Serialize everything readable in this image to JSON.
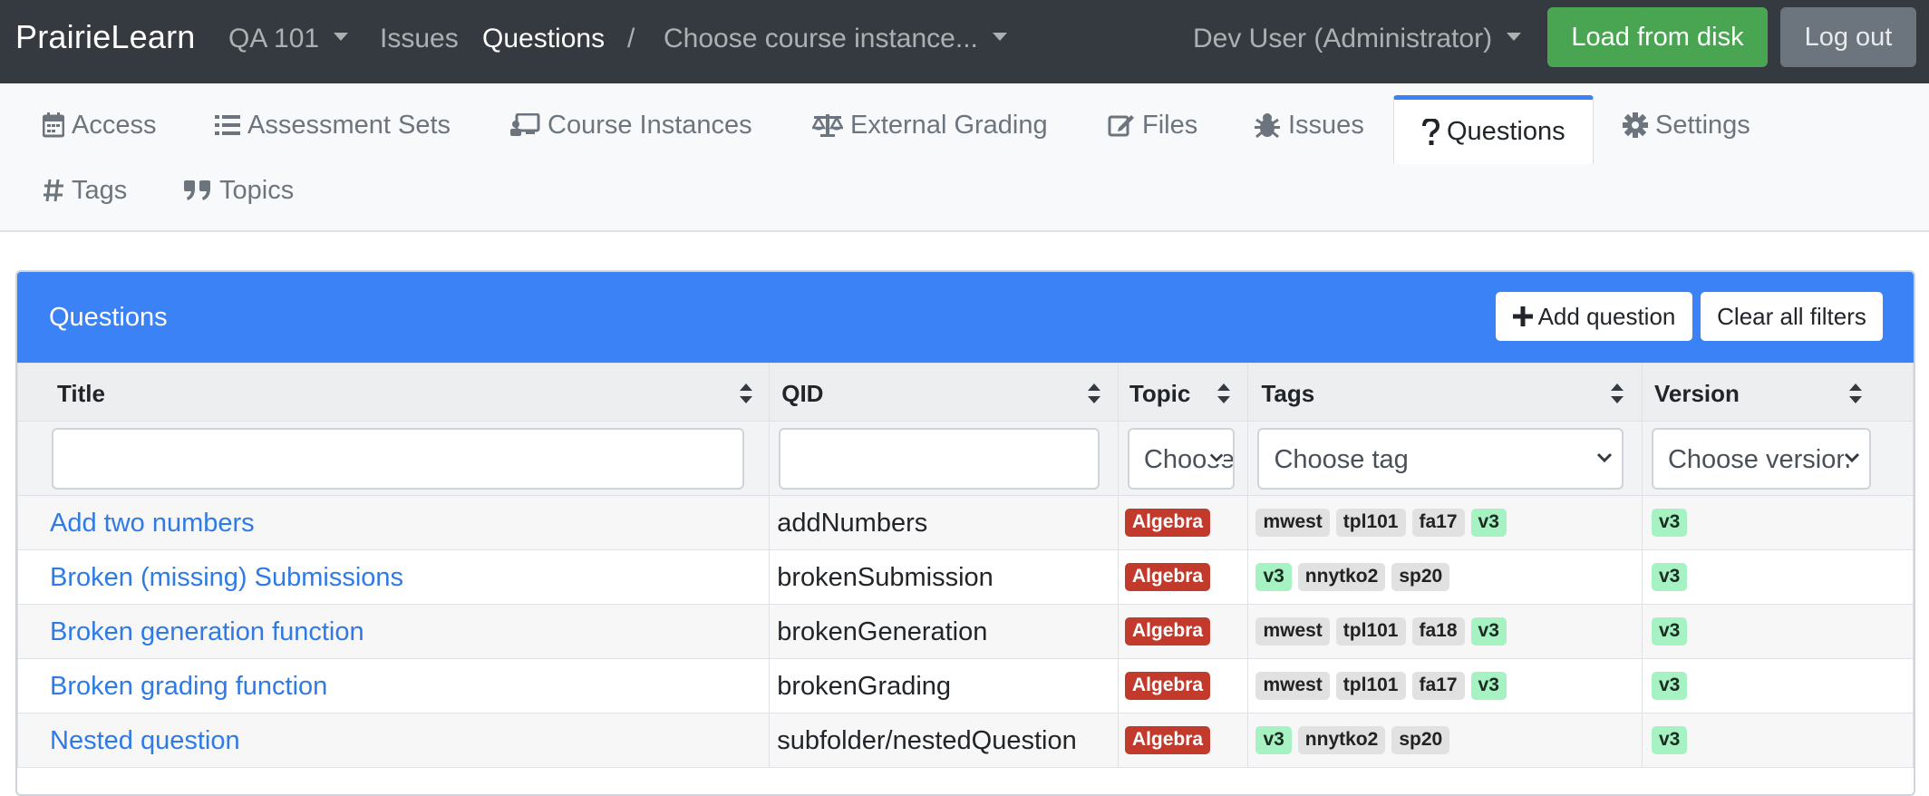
{
  "navbar": {
    "brand": "PrairieLearn",
    "course": "QA 101",
    "issues": "Issues",
    "questions": "Questions",
    "separator": "/",
    "instance": "Choose course instance...",
    "user": "Dev User (Administrator)",
    "load_button": "Load from disk",
    "logout_button": "Log out"
  },
  "tabs": [
    {
      "label": "Access",
      "icon": "calendar-icon"
    },
    {
      "label": "Assessment Sets",
      "icon": "list-icon"
    },
    {
      "label": "Course Instances",
      "icon": "chalkboard-icon"
    },
    {
      "label": "External Grading",
      "icon": "balance-scale-icon"
    },
    {
      "label": "Files",
      "icon": "edit-icon"
    },
    {
      "label": "Issues",
      "icon": "bug-icon"
    },
    {
      "label": "Questions",
      "icon": "question-icon",
      "active": true
    },
    {
      "label": "Settings",
      "icon": "gear-icon"
    },
    {
      "label": "Tags",
      "icon": "hashtag-icon"
    },
    {
      "label": "Topics",
      "icon": "quote-icon"
    }
  ],
  "card": {
    "title": "Questions",
    "add_button": "Add question",
    "clear_button": "Clear all filters"
  },
  "table": {
    "columns": [
      "Title",
      "QID",
      "Topic",
      "Tags",
      "Version"
    ],
    "filters": {
      "topic_placeholder": "Choose topic",
      "tag_placeholder": "Choose tag",
      "version_placeholder": "Choose version"
    },
    "rows": [
      {
        "title": "Add two numbers",
        "qid": "addNumbers",
        "topic": "Algebra",
        "tags": [
          "mwest",
          "tpl101",
          "fa17",
          "v3"
        ],
        "version": "v3"
      },
      {
        "title": "Broken (missing) Submissions",
        "qid": "brokenSubmission",
        "topic": "Algebra",
        "tags": [
          "v3",
          "nnytko2",
          "sp20"
        ],
        "version": "v3"
      },
      {
        "title": "Broken generation function",
        "qid": "brokenGeneration",
        "topic": "Algebra",
        "tags": [
          "mwest",
          "tpl101",
          "fa18",
          "v3"
        ],
        "version": "v3"
      },
      {
        "title": "Broken grading function",
        "qid": "brokenGrading",
        "topic": "Algebra",
        "tags": [
          "mwest",
          "tpl101",
          "fa17",
          "v3"
        ],
        "version": "v3"
      },
      {
        "title": "Nested question",
        "qid": "subfolder/nestedQuestion",
        "topic": "Algebra",
        "tags": [
          "v3",
          "nnytko2",
          "sp20"
        ],
        "version": "v3"
      }
    ]
  },
  "colors": {
    "navbar_bg": "#343a40",
    "primary": "#3b82f6",
    "success": "#4aa552",
    "topic_badge": "#c23a2b",
    "tag_badge": "#e1e1e1",
    "version_badge": "#a6f2c3"
  }
}
